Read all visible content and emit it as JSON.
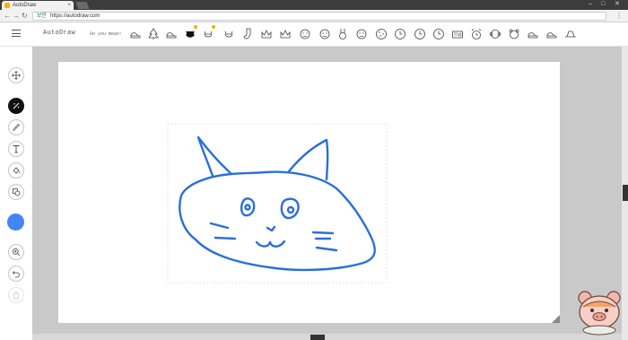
{
  "browser": {
    "tab_title": "AutoDraw",
    "tab_close": "×",
    "url": "https://autodraw.com",
    "secure_label": "보안",
    "win_min": "–",
    "win_max": "□",
    "win_close": "✕"
  },
  "header": {
    "brand": "AutoDraw",
    "suggest_label": "Do you mean:",
    "suggestions": [
      "shoe",
      "tree",
      "shoe",
      "cat",
      "cat",
      "cat",
      "sock",
      "crown",
      "crown",
      "face",
      "face",
      "bunny",
      "face",
      "cookie",
      "clock",
      "clock",
      "clock",
      "radio",
      "alarm-clock",
      "monkey",
      "teddy-bear",
      "shoe",
      "shoe",
      "hat"
    ]
  },
  "toolbar": {
    "tools": [
      "move",
      "autodraw",
      "draw",
      "type",
      "fill",
      "shape",
      "color",
      "zoom",
      "undo",
      "delete"
    ],
    "active_tool": "autodraw",
    "active_color": "#4285f4"
  },
  "canvas": {
    "stroke_color": "#2a6fdb",
    "subject": "cat face"
  }
}
